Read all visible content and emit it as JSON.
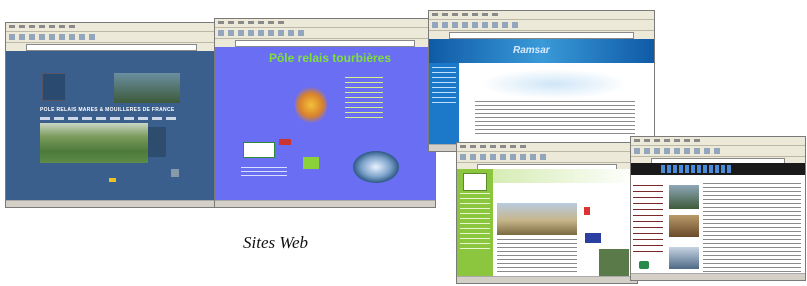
{
  "caption": "Sites Web",
  "windows": [
    {
      "name": "browser-window-1",
      "banner_text": "PÔLE RELAIS MARES & MOUILLÈRES DE FRANCE",
      "accent": "#3a5f8c"
    },
    {
      "name": "browser-window-2",
      "title_text": "Pôle relais tourbières",
      "accent": "#6a6ef2"
    },
    {
      "name": "browser-window-3",
      "header_text": "Ramsar",
      "accent": "#1c79c9"
    },
    {
      "name": "browser-window-4",
      "accent": "#8cc63f"
    },
    {
      "name": "browser-window-5",
      "accent": "#1a1a1a"
    }
  ]
}
